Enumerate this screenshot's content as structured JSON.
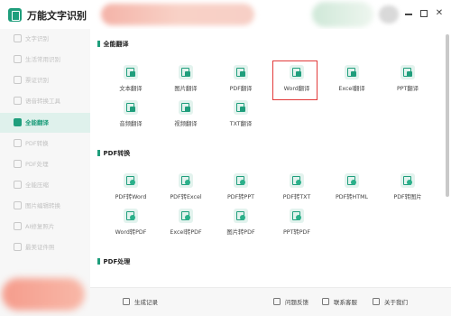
{
  "app": {
    "title": "万能文字识别",
    "window_controls": {
      "minimize_icon": "minimize-icon",
      "maximize_icon": "maximize-icon",
      "close_icon": "close-icon"
    }
  },
  "sidebar": {
    "items": [
      {
        "label": "文字识别",
        "icon": "text-recognition-icon",
        "active": false
      },
      {
        "label": "生活常用识别",
        "icon": "life-recognition-icon",
        "active": false
      },
      {
        "label": "票证识别",
        "icon": "ticket-recognition-icon",
        "active": false
      },
      {
        "label": "语音转换工具",
        "icon": "voice-tool-icon",
        "active": false
      },
      {
        "label": "全能翻译",
        "icon": "translate-icon",
        "active": true
      },
      {
        "label": "PDF转换",
        "icon": "pdf-convert-icon",
        "active": false
      },
      {
        "label": "PDF处理",
        "icon": "pdf-process-icon",
        "active": false
      },
      {
        "label": "全能压缩",
        "icon": "compress-icon",
        "active": false
      },
      {
        "label": "图片编辑转换",
        "icon": "image-edit-icon",
        "active": false
      },
      {
        "label": "AI修复照片",
        "icon": "ai-photo-icon",
        "active": false
      },
      {
        "label": "最美证件照",
        "icon": "id-photo-icon",
        "active": false
      }
    ]
  },
  "sections": [
    {
      "title": "全能翻译",
      "tools": [
        {
          "label": "文本翻译",
          "icon": "text-translate-icon"
        },
        {
          "label": "图片翻译",
          "icon": "image-translate-icon"
        },
        {
          "label": "PDF翻译",
          "icon": "pdf-translate-icon"
        },
        {
          "label": "Word翻译",
          "icon": "word-translate-icon",
          "highlighted": true
        },
        {
          "label": "Excel翻译",
          "icon": "excel-translate-icon"
        },
        {
          "label": "PPT翻译",
          "icon": "ppt-translate-icon"
        },
        {
          "label": "音频翻译",
          "icon": "audio-translate-icon"
        },
        {
          "label": "视频翻译",
          "icon": "video-translate-icon"
        },
        {
          "label": "TXT翻译",
          "icon": "txt-translate-icon"
        }
      ]
    },
    {
      "title": "PDF转换",
      "tools": [
        {
          "label": "PDF转Word",
          "icon": "pdf-to-word-icon"
        },
        {
          "label": "PDF转Excel",
          "icon": "pdf-to-excel-icon"
        },
        {
          "label": "PDF转PPT",
          "icon": "pdf-to-ppt-icon"
        },
        {
          "label": "PDF转TXT",
          "icon": "pdf-to-txt-icon"
        },
        {
          "label": "PDF转HTML",
          "icon": "pdf-to-html-icon"
        },
        {
          "label": "PDF转图片",
          "icon": "pdf-to-image-icon"
        },
        {
          "label": "Word转PDF",
          "icon": "word-to-pdf-icon"
        },
        {
          "label": "Excel转PDF",
          "icon": "excel-to-pdf-icon"
        },
        {
          "label": "图片转PDF",
          "icon": "image-to-pdf-icon"
        },
        {
          "label": "PPT转PDF",
          "icon": "ppt-to-pdf-icon"
        }
      ]
    },
    {
      "title": "PDF处理",
      "tools": []
    }
  ],
  "bottombar": {
    "history": {
      "label": "生成记录",
      "icon": "history-icon"
    },
    "feedback": {
      "label": "问题反馈",
      "icon": "feedback-icon"
    },
    "support": {
      "label": "联系客服",
      "icon": "support-icon"
    },
    "about": {
      "label": "关于我们",
      "icon": "info-icon"
    }
  },
  "colors": {
    "accent": "#1f9e7c",
    "highlight": "#e23a3a",
    "sidebar_active_bg": "#dff1ec"
  }
}
